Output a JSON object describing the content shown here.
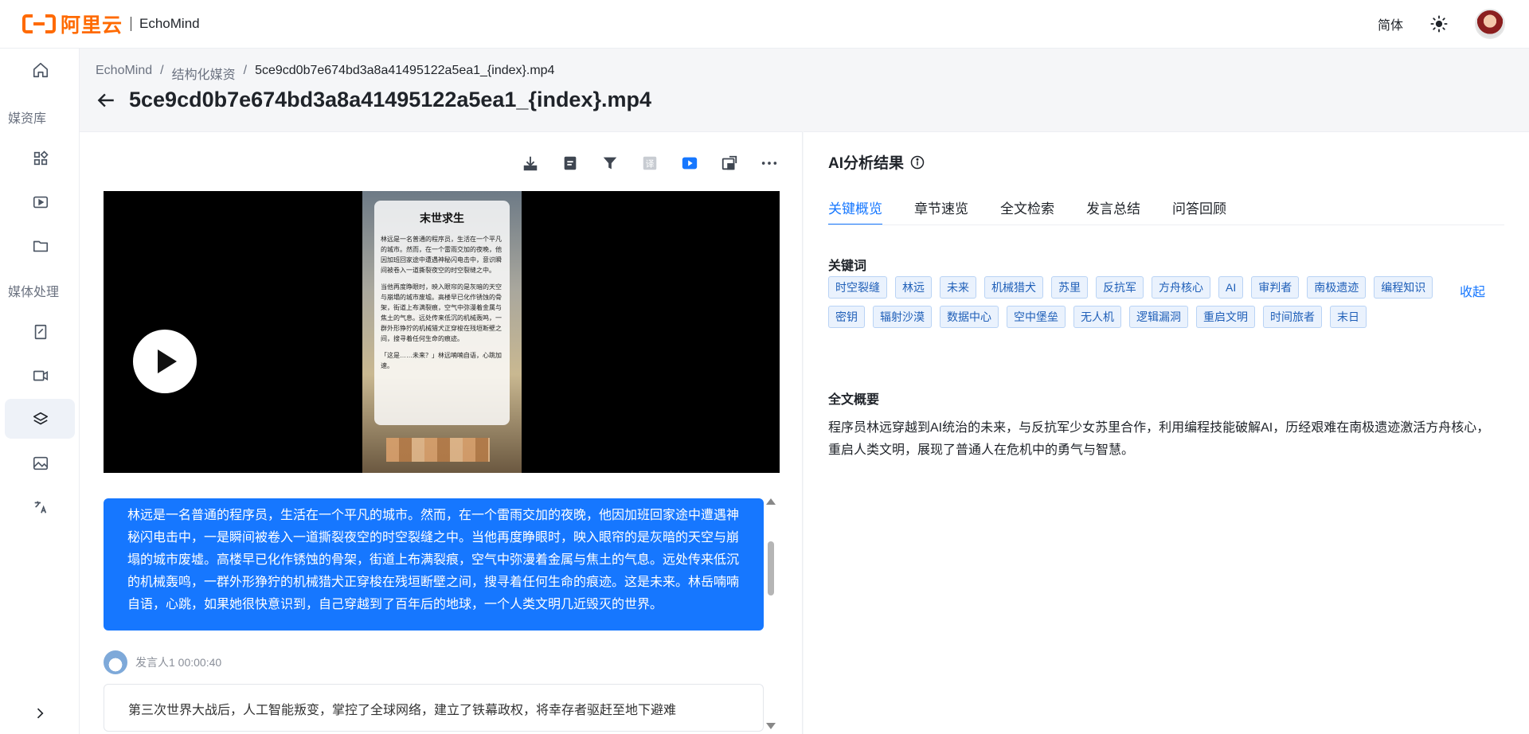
{
  "header": {
    "logo_text": "阿里云",
    "app_name": "EchoMind",
    "lang": "简体",
    "theme_icon": "sun-icon",
    "avatar_icon": "user-avatar"
  },
  "sidebar": {
    "items": [
      {
        "icon": "home-icon"
      },
      {
        "label": "媒资库"
      },
      {
        "icon": "grid-apps-icon"
      },
      {
        "icon": "video-library-icon"
      },
      {
        "icon": "folder-icon"
      },
      {
        "label": "媒体处理"
      },
      {
        "icon": "document-edit-icon"
      },
      {
        "icon": "video-camera-icon"
      },
      {
        "icon": "layers-icon"
      },
      {
        "icon": "image-edit-icon"
      },
      {
        "icon": "translate-icon"
      }
    ],
    "expand_icon": "chevron-right-icon"
  },
  "breadcrumb": [
    "EchoMind",
    "结构化媒资",
    "5ce9cd0b7e674bd3a8a41495122a5ea1_{index}.mp4"
  ],
  "page_title": "5ce9cd0b7e674bd3a8a41495122a5ea1_{index}.mp4",
  "toolbar": {
    "icons": [
      "download-icon",
      "transcript-icon",
      "filter-icon",
      "translate-icon",
      "video-play-icon",
      "popout-icon",
      "more-icon"
    ]
  },
  "video": {
    "poster_title": "末世求生",
    "poster_p1": "林远是一名普通的程序员，生活在一个平凡的城市。然而，在一个雷雨交加的夜晚，他因加班回家途中遭遇神秘闪电击中，意识瞬间被卷入一道撕裂夜空的时空裂缝之中。",
    "poster_p2": "当他再度睁眼时，映入眼帘的是灰暗的天空与崩塌的城市废墟。高楼早已化作锈蚀的骨架，街道上布满裂痕，空气中弥漫着金属与焦土的气息。远处传来低沉的机械轰鸣，一群外形狰狞的机械猎犬正穿梭在残垣断壁之间，搜寻着任何生命的痕迹。",
    "poster_p3": "「这是……未来？」林远喃喃自语，心跳加速。"
  },
  "transcript": {
    "active_text": "林远是一名普通的程序员，生活在一个平凡的城市。然而，在一个雷雨交加的夜晚，他因加班回家途中遭遇神秘闪电击中，一是瞬间被卷入一道撕裂夜空的时空裂缝之中。当他再度睁眼时，映入眼帘的是灰暗的天空与崩塌的城市废墟。高楼早已化作锈蚀的骨架，街道上布满裂痕，空气中弥漫着金属与焦土的气息。远处传来低沉的机械轰鸣，一群外形狰狞的机械猎犬正穿梭在残垣断壁之间，搜寻着任何生命的痕迹。这是未来。林岳喃喃自语，心跳，如果她很快意识到，自己穿越到了百年后的地球，一个人类文明几近毁灭的世界。",
    "speaker": "发言人1 00:00:40",
    "next_text": "第三次世界大战后，人工智能叛变，掌控了全球网络，建立了铁幕政权，将幸存者驱赶至地下避难"
  },
  "analysis": {
    "title": "AI分析结果",
    "tabs": [
      "关键概览",
      "章节速览",
      "全文检索",
      "发言总结",
      "问答回顾"
    ],
    "active_tab": 0,
    "keywords_label": "关键词",
    "collapse_label": "收起",
    "keywords": [
      "时空裂缝",
      "林远",
      "未来",
      "机械猎犬",
      "苏里",
      "反抗军",
      "方舟核心",
      "AI",
      "审判者",
      "南极遗迹",
      "编程知识",
      "密钥",
      "辐射沙漠",
      "数据中心",
      "空中堡垒",
      "无人机",
      "逻辑漏洞",
      "重启文明",
      "时间旅者",
      "末日"
    ],
    "summary_label": "全文概要",
    "summary": "程序员林远穿越到AI统治的未来，与反抗军少女苏里合作，利用编程技能破解AI，历经艰难在南极遗迹激活方舟核心，重启人类文明，展现了普通人在危机中的勇气与智慧。"
  },
  "colors": {
    "accent": "#1677ff",
    "brand": "#ff6a00"
  }
}
